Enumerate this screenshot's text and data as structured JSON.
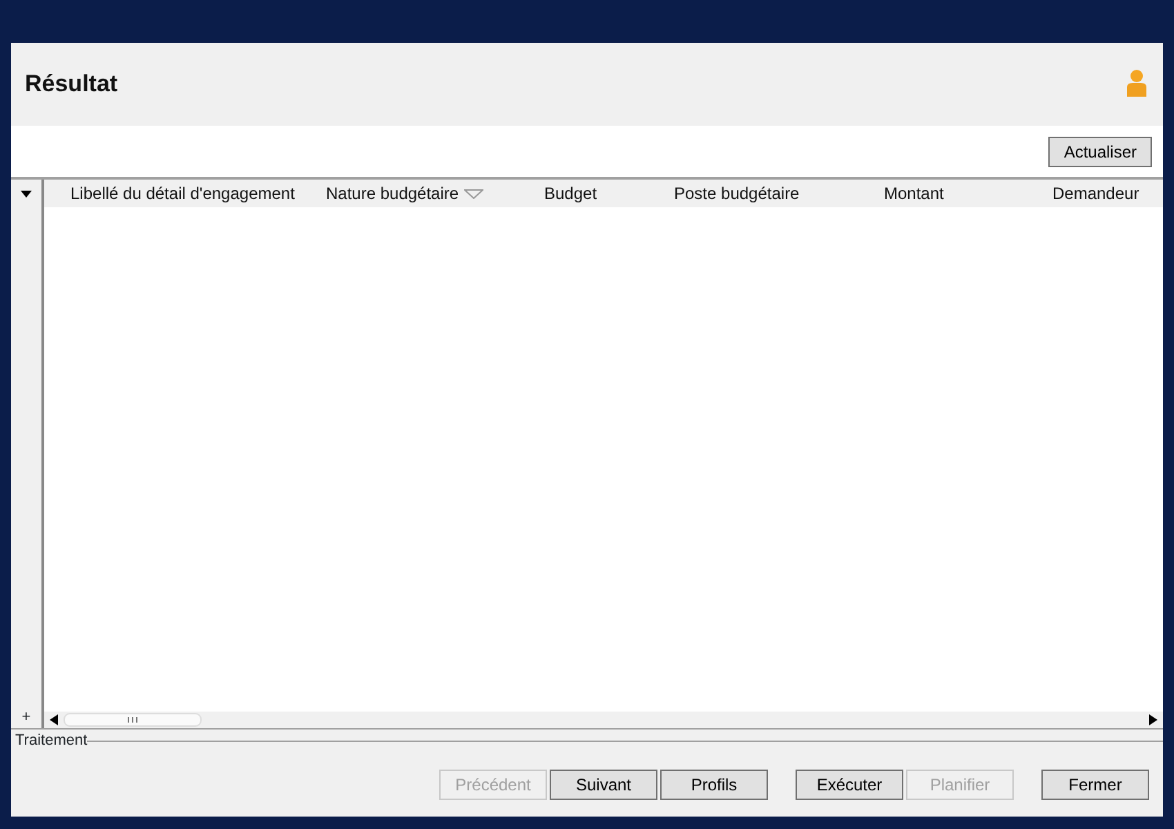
{
  "title": "Résultat",
  "refresh_button": {
    "label": "Actualiser"
  },
  "table": {
    "columns": [
      {
        "label": "Libellé du détail d'engagement",
        "sorted": false
      },
      {
        "label": "Nature budgétaire",
        "sorted": true
      },
      {
        "label": "Budget",
        "sorted": false
      },
      {
        "label": "Poste budgétaire",
        "sorted": false
      },
      {
        "label": "Montant",
        "sorted": false
      },
      {
        "label": "Demandeur",
        "sorted": false
      }
    ],
    "expand_symbol": "+"
  },
  "section_label": "Traitement",
  "button_groups": [
    [
      {
        "label": "Précédent",
        "disabled": true
      },
      {
        "label": "Suivant",
        "disabled": false
      },
      {
        "label": "Profils",
        "disabled": false
      }
    ],
    [
      {
        "label": "Exécuter",
        "disabled": false
      },
      {
        "label": "Planifier",
        "disabled": true
      }
    ],
    [
      {
        "label": "Fermer",
        "disabled": false
      }
    ]
  ]
}
